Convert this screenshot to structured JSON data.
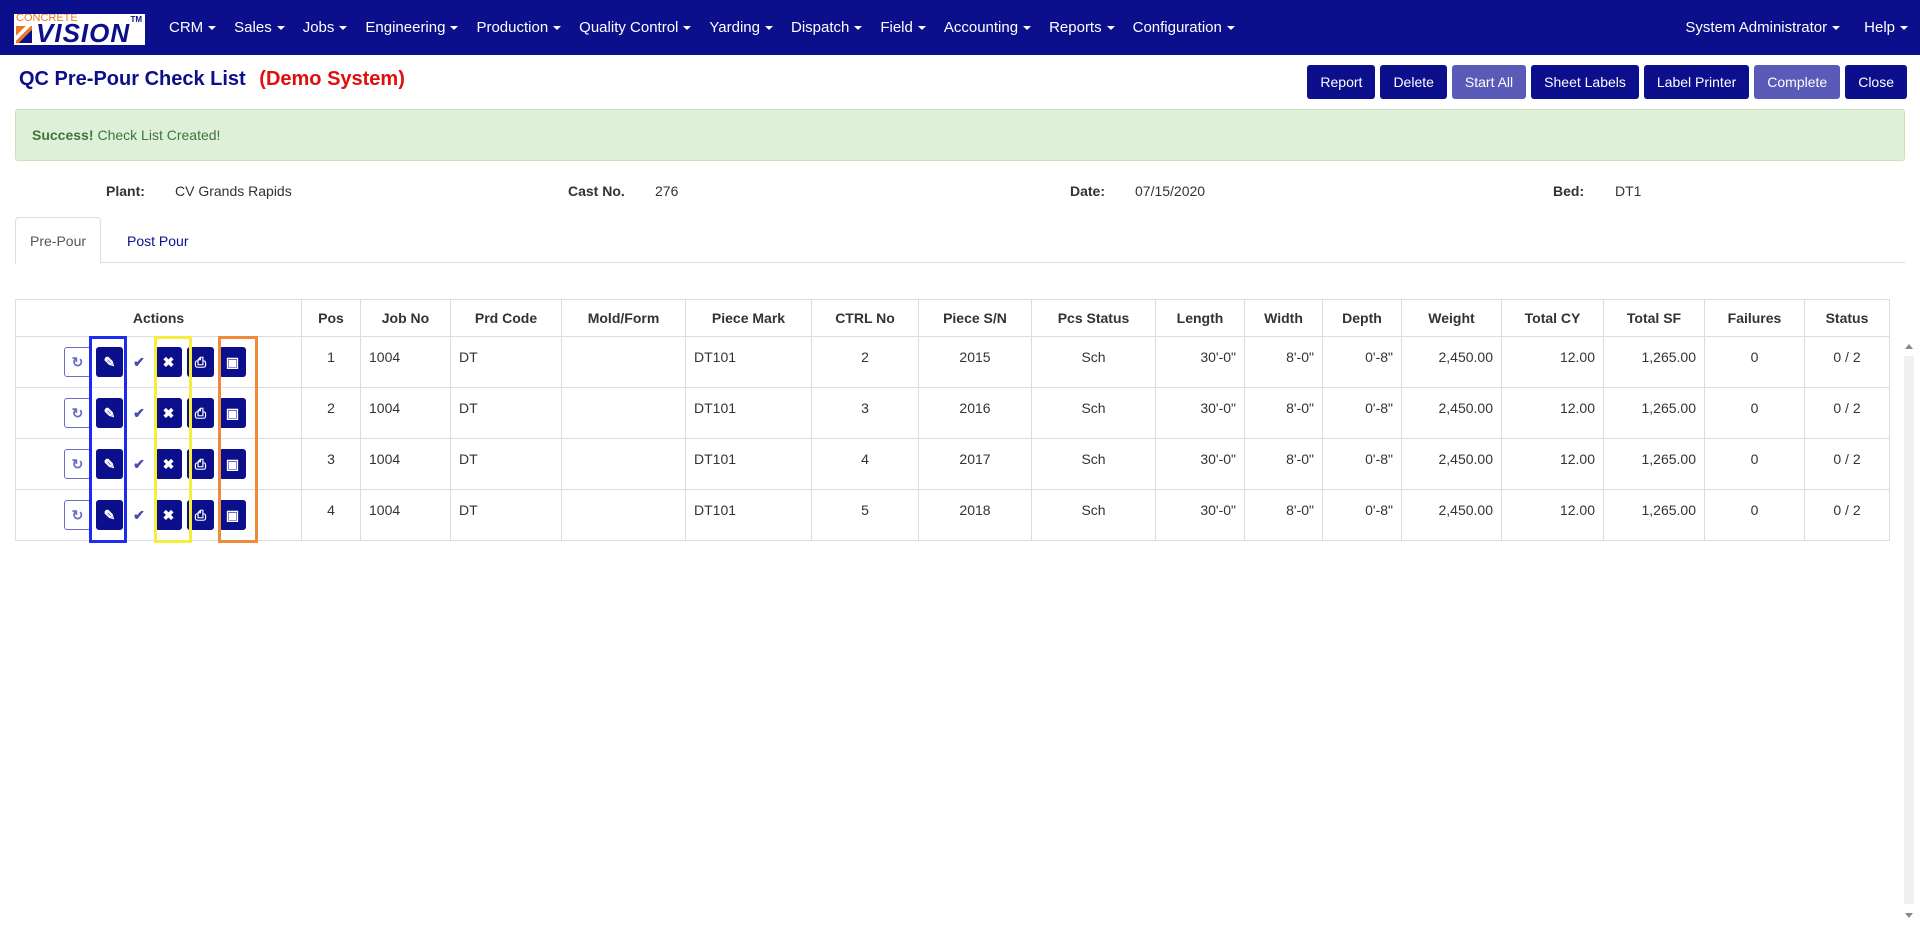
{
  "brand": {
    "logo_top": "CONCRETE",
    "logo_main": "VISION",
    "logo_tm": "TM"
  },
  "nav": {
    "items": [
      "CRM",
      "Sales",
      "Jobs",
      "Engineering",
      "Production",
      "Quality Control",
      "Yarding",
      "Dispatch",
      "Field",
      "Accounting",
      "Reports",
      "Configuration"
    ],
    "user": "System Administrator",
    "help": "Help"
  },
  "header": {
    "title": "QC Pre-Pour Check List",
    "demo_label": "(Demo System)"
  },
  "toolbar": {
    "report": "Report",
    "delete": "Delete",
    "start_all": "Start All",
    "sheet_labels": "Sheet Labels",
    "label_printer": "Label Printer",
    "complete": "Complete",
    "close": "Close"
  },
  "alert": {
    "strong": "Success!",
    "text": "Check List Created!"
  },
  "info": {
    "plant_label": "Plant:",
    "plant_value": "CV Grands Rapids",
    "cast_label": "Cast No.",
    "cast_value": "276",
    "date_label": "Date:",
    "date_value": "07/15/2020",
    "bed_label": "Bed:",
    "bed_value": "DT1"
  },
  "tabs": {
    "pre_pour": "Pre-Pour",
    "post_pour": "Post Pour"
  },
  "table": {
    "headers": [
      "Actions",
      "Pos",
      "Job No",
      "Prd Code",
      "Mold/Form",
      "Piece Mark",
      "CTRL No",
      "Piece S/N",
      "Pcs Status",
      "Length",
      "Width",
      "Depth",
      "Weight",
      "Total CY",
      "Total SF",
      "Failures",
      "Status"
    ],
    "rows": [
      {
        "pos": "1",
        "job": "1004",
        "prd": "DT",
        "mold": "",
        "mark": "DT101",
        "ctrl": "2",
        "sn": "2015",
        "status": "Sch",
        "length": "30'-0\"",
        "width": "8'-0\"",
        "depth": "0'-8\"",
        "weight": "2,450.00",
        "cy": "12.00",
        "sf": "1,265.00",
        "failures": "0",
        "state": "0 / 2"
      },
      {
        "pos": "2",
        "job": "1004",
        "prd": "DT",
        "mold": "",
        "mark": "DT101",
        "ctrl": "3",
        "sn": "2016",
        "status": "Sch",
        "length": "30'-0\"",
        "width": "8'-0\"",
        "depth": "0'-8\"",
        "weight": "2,450.00",
        "cy": "12.00",
        "sf": "1,265.00",
        "failures": "0",
        "state": "0 / 2"
      },
      {
        "pos": "3",
        "job": "1004",
        "prd": "DT",
        "mold": "",
        "mark": "DT101",
        "ctrl": "4",
        "sn": "2017",
        "status": "Sch",
        "length": "30'-0\"",
        "width": "8'-0\"",
        "depth": "0'-8\"",
        "weight": "2,450.00",
        "cy": "12.00",
        "sf": "1,265.00",
        "failures": "0",
        "state": "0 / 2"
      },
      {
        "pos": "4",
        "job": "1004",
        "prd": "DT",
        "mold": "",
        "mark": "DT101",
        "ctrl": "5",
        "sn": "2018",
        "status": "Sch",
        "length": "30'-0\"",
        "width": "8'-0\"",
        "depth": "0'-8\"",
        "weight": "2,450.00",
        "cy": "12.00",
        "sf": "1,265.00",
        "failures": "0",
        "state": "0 / 2"
      }
    ],
    "action_icons": [
      "refresh-icon",
      "edit-icon",
      "check-icon",
      "close-icon",
      "print-icon",
      "image-icon"
    ]
  },
  "colors": {
    "brand": "#0b0f8c",
    "demo": "#e30d0d",
    "alert_bg": "#dff0d8",
    "highlight_blue": "#1f2cf0",
    "highlight_yellow": "#f5ee3c",
    "highlight_orange": "#ef8a3b"
  }
}
